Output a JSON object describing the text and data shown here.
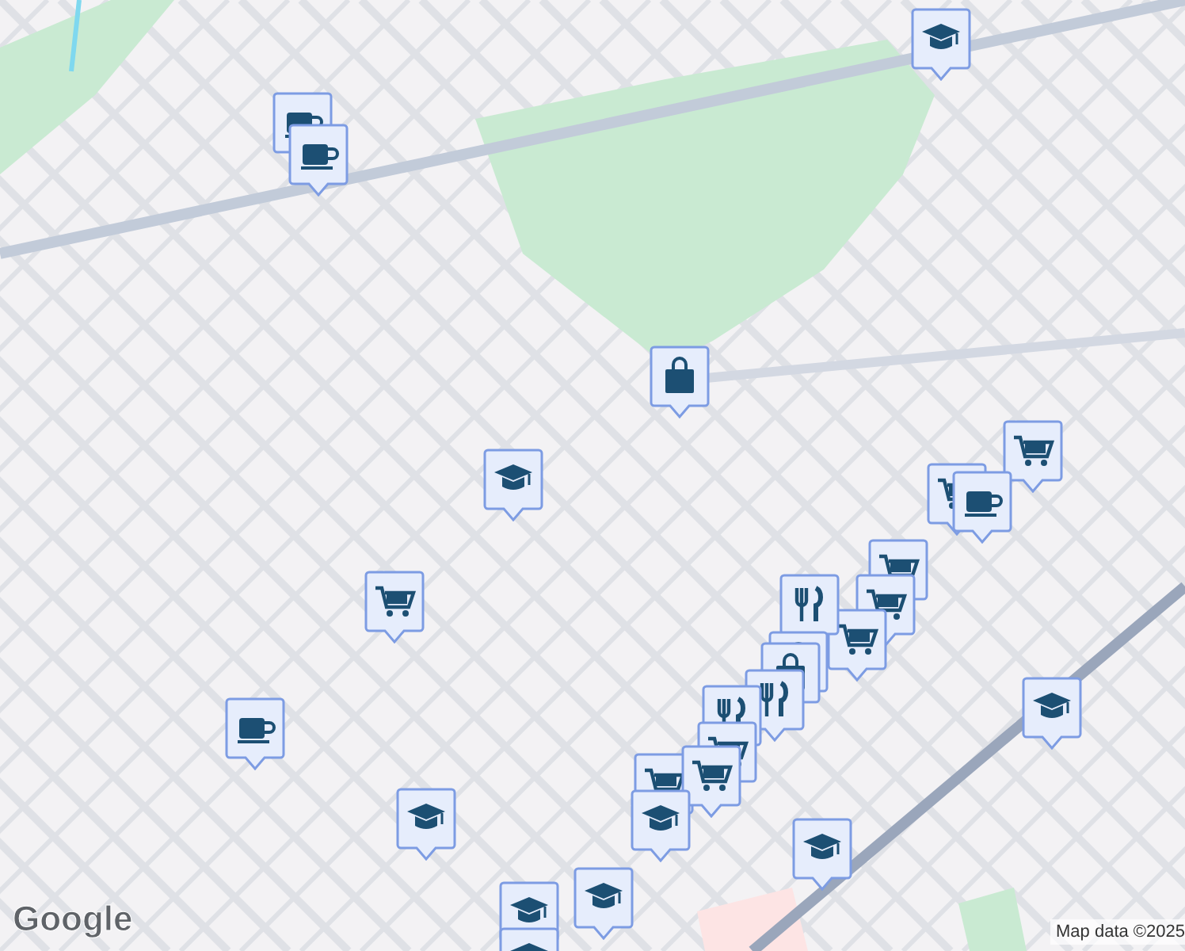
{
  "map": {
    "pins": [
      {
        "kind": "school"
      },
      {
        "kind": "cafe"
      },
      {
        "kind": "cafe"
      },
      {
        "kind": "shopping"
      },
      {
        "kind": "cart"
      },
      {
        "kind": "cart"
      },
      {
        "kind": "cafe"
      },
      {
        "kind": "school"
      },
      {
        "kind": "cart"
      },
      {
        "kind": "cafe"
      },
      {
        "kind": "school"
      },
      {
        "kind": "school"
      },
      {
        "kind": "school"
      },
      {
        "kind": "school"
      },
      {
        "kind": "school"
      },
      {
        "kind": "school"
      },
      {
        "kind": "cart"
      },
      {
        "kind": "cart"
      },
      {
        "kind": "cart"
      },
      {
        "kind": "restaurant"
      },
      {
        "kind": "shopping"
      },
      {
        "kind": "shopping"
      },
      {
        "kind": "restaurant"
      },
      {
        "kind": "restaurant"
      },
      {
        "kind": "cart"
      },
      {
        "kind": "cart"
      },
      {
        "kind": "cart"
      },
      {
        "kind": "school"
      }
    ]
  },
  "attribution": {
    "logo": "Google",
    "text": "Map data ©2025"
  }
}
